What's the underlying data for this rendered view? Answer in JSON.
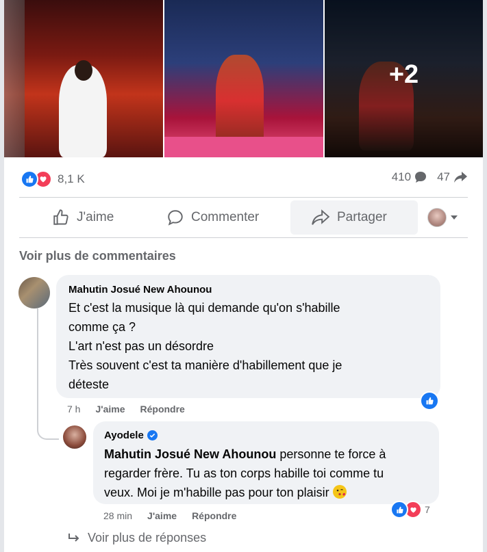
{
  "post": {
    "photos": [
      {
        "name": "performer-white-dress"
      },
      {
        "name": "dancer-on-stage"
      },
      {
        "name": "dancers-overlay",
        "more_label": "+2"
      }
    ],
    "reactions": {
      "count": "8,1 K",
      "types": [
        "like-icon",
        "love-icon"
      ]
    },
    "comments_count": "410",
    "shares_count": "47",
    "actions": {
      "like": "J'aime",
      "comment": "Commenter",
      "share": "Partager"
    }
  },
  "comments_section": {
    "see_more_label": "Voir plus de commentaires",
    "comments": [
      {
        "author": "Mahutin Josué New Ahounou",
        "text_lines": [
          "Et c'est la musique là qui demande qu'on s'habille",
          "comme ça ?",
          "L'art n'est pas un désordre",
          "Très souvent c'est ta manière d'habillement que je",
          "déteste"
        ],
        "time": "7 h",
        "like_label": "J'aime",
        "reply_label": "Répondre",
        "reactions": [
          "like-icon"
        ]
      }
    ],
    "reply": {
      "author": "Ayodele",
      "verified": true,
      "mention": "Mahutin Josué New Ahounou",
      "text_first": " personne te force à",
      "text_lines": [
        "regarder frère. Tu as ton corps habille toi comme tu",
        "veux. Moi je m'habille pas pour ton plaisir"
      ],
      "emoji": "kiss-face-emoji",
      "time": "28 min",
      "like_label": "J'aime",
      "reply_label": "Répondre",
      "reaction_count": "7",
      "reactions": [
        "like-icon",
        "love-icon"
      ]
    },
    "more_replies_label": "Voir plus de réponses"
  },
  "colors": {
    "accent": "#1877f2",
    "love": "#f33e58",
    "muted": "#65676b",
    "bubble": "#f0f2f5"
  }
}
